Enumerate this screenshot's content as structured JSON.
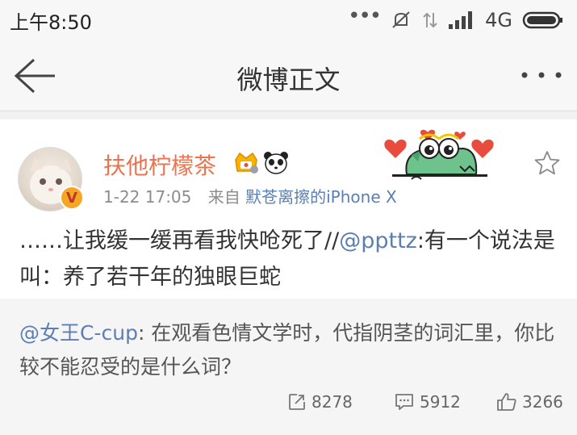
{
  "status_bar": {
    "time": "上午8:50",
    "network": "4G"
  },
  "nav": {
    "title": "微博正文"
  },
  "post": {
    "username": "扶他柠檬茶",
    "timestamp": "1-22 17:05",
    "source_label": "来自",
    "source": "默苍离擦的iPhone X",
    "text_before": "……让我缓一缓再看我快呛死了//",
    "mention": "@ppttz",
    "text_after": ":有一个说法是叫：养了若干年的独眼巨蛇"
  },
  "repost": {
    "author": "@女王C-cup",
    "text": ": 在观看色情文学时，代指阴茎的词汇里，你比较不能忍受的是什么词？"
  },
  "actions": {
    "reposts": "8278",
    "comments": "5912",
    "likes": "3266"
  },
  "colors": {
    "username": "#eb7350",
    "link": "#5b7fb3",
    "background": "#f2f2f2"
  },
  "icons": [
    "back-arrow-icon",
    "more-icon",
    "verified-icon",
    "vip-icon",
    "panda-icon",
    "star-icon",
    "repost-icon",
    "comment-icon",
    "like-icon"
  ]
}
